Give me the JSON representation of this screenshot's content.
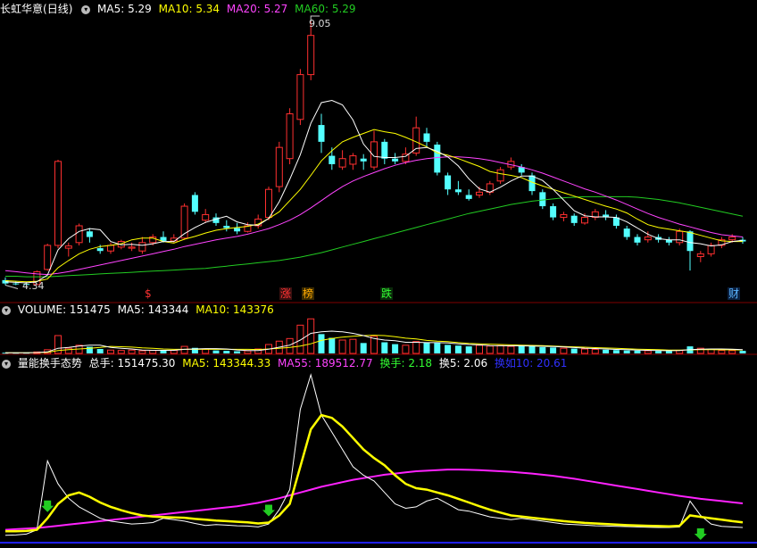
{
  "header": {
    "title": "长虹华意",
    "period": "(日线)",
    "ma5": "MA5: 5.29",
    "ma10": "MA10: 5.34",
    "ma20": "MA20: 5.27",
    "ma60": "MA60: 5.29"
  },
  "volume_header": {
    "title": "VOLUME: 151475",
    "ma5": "MA5: 143344",
    "ma10": "MA10: 143376"
  },
  "indicator_header": {
    "title": "量能换手态势",
    "total": "总手: 151475.30",
    "ma5": "MA5: 143344.33",
    "ma55": "MA55: 189512.77",
    "turnover": "换手: 2.18",
    "turnover5": "换5: 2.06",
    "turnover10": "换如10: 20.61"
  },
  "events": [
    {
      "label": "$",
      "color": "#ff3333",
      "bg": "none"
    },
    {
      "label": "涨",
      "color": "#ff3333",
      "bg": "#3a1010"
    },
    {
      "label": "榜",
      "color": "#ffaa00",
      "bg": "#3a2a00"
    },
    {
      "label": "跌",
      "color": "#33ff33",
      "bg": "#0a2a0a"
    },
    {
      "label": "财",
      "color": "#5ab4ff",
      "bg": "#0a2040"
    }
  ],
  "colors": {
    "up": "#ff3030",
    "down": "#54ffff",
    "ma5": "#ffffff",
    "ma10": "#ffff00",
    "ma20": "#ff44ff",
    "ma60": "#22cc22",
    "divider": "#800000",
    "bottom_axis": "#2020ff"
  },
  "chart_data": {
    "type": "candlestick",
    "price_high": "9.05",
    "price_low": "4.34",
    "n": 71,
    "candles": [
      {
        "o": 4.43,
        "c": 4.37,
        "h": 4.48,
        "l": 4.34
      },
      {
        "o": 4.37,
        "c": 4.36,
        "h": 4.41,
        "l": 4.34
      },
      {
        "o": 4.36,
        "c": 4.35,
        "h": 4.4,
        "l": 4.34
      },
      {
        "o": 4.35,
        "c": 4.58,
        "h": 4.6,
        "l": 4.34
      },
      {
        "o": 4.62,
        "c": 5.05,
        "h": 5.08,
        "l": 4.6
      },
      {
        "o": 5.05,
        "c": 6.55,
        "h": 6.58,
        "l": 5.0
      },
      {
        "o": 5.0,
        "c": 5.04,
        "h": 5.1,
        "l": 4.85
      },
      {
        "o": 5.1,
        "c": 5.4,
        "h": 5.44,
        "l": 5.05
      },
      {
        "o": 5.3,
        "c": 5.2,
        "h": 5.36,
        "l": 5.1
      },
      {
        "o": 5.0,
        "c": 4.95,
        "h": 5.06,
        "l": 4.9
      },
      {
        "o": 4.95,
        "c": 5.05,
        "h": 5.1,
        "l": 4.9
      },
      {
        "o": 5.02,
        "c": 5.12,
        "h": 5.15,
        "l": 4.98
      },
      {
        "o": 5.0,
        "c": 5.02,
        "h": 5.1,
        "l": 4.95
      },
      {
        "o": 4.95,
        "c": 5.1,
        "h": 5.2,
        "l": 4.9
      },
      {
        "o": 5.1,
        "c": 5.2,
        "h": 5.25,
        "l": 5.05
      },
      {
        "o": 5.2,
        "c": 5.13,
        "h": 5.3,
        "l": 5.1
      },
      {
        "o": 5.13,
        "c": 5.18,
        "h": 5.25,
        "l": 5.1
      },
      {
        "o": 5.18,
        "c": 5.75,
        "h": 5.8,
        "l": 5.15
      },
      {
        "o": 5.95,
        "c": 5.65,
        "h": 6.0,
        "l": 5.6
      },
      {
        "o": 5.5,
        "c": 5.6,
        "h": 5.7,
        "l": 5.45
      },
      {
        "o": 5.55,
        "c": 5.45,
        "h": 5.62,
        "l": 5.4
      },
      {
        "o": 5.4,
        "c": 5.36,
        "h": 5.5,
        "l": 5.3
      },
      {
        "o": 5.36,
        "c": 5.3,
        "h": 5.45,
        "l": 5.25
      },
      {
        "o": 5.3,
        "c": 5.4,
        "h": 5.46,
        "l": 5.28
      },
      {
        "o": 5.4,
        "c": 5.52,
        "h": 5.6,
        "l": 5.35
      },
      {
        "o": 5.55,
        "c": 6.05,
        "h": 6.1,
        "l": 5.5
      },
      {
        "o": 6.1,
        "c": 6.8,
        "h": 6.9,
        "l": 6.0
      },
      {
        "o": 6.6,
        "c": 7.4,
        "h": 7.5,
        "l": 6.5
      },
      {
        "o": 7.3,
        "c": 8.1,
        "h": 8.2,
        "l": 7.2
      },
      {
        "o": 8.1,
        "c": 8.8,
        "h": 9.05,
        "l": 8.0
      },
      {
        "o": 7.2,
        "c": 6.9,
        "h": 7.4,
        "l": 6.7
      },
      {
        "o": 6.65,
        "c": 6.5,
        "h": 6.8,
        "l": 6.4
      },
      {
        "o": 6.45,
        "c": 6.6,
        "h": 6.75,
        "l": 6.4
      },
      {
        "o": 6.5,
        "c": 6.65,
        "h": 6.7,
        "l": 6.4
      },
      {
        "o": 6.6,
        "c": 6.55,
        "h": 6.68,
        "l": 6.4
      },
      {
        "o": 6.45,
        "c": 6.9,
        "h": 7.1,
        "l": 6.4
      },
      {
        "o": 6.9,
        "c": 6.6,
        "h": 6.95,
        "l": 6.5
      },
      {
        "o": 6.6,
        "c": 6.55,
        "h": 6.7,
        "l": 6.5
      },
      {
        "o": 6.55,
        "c": 6.68,
        "h": 6.8,
        "l": 6.5
      },
      {
        "o": 6.7,
        "c": 7.15,
        "h": 7.35,
        "l": 6.65
      },
      {
        "o": 7.05,
        "c": 6.9,
        "h": 7.15,
        "l": 6.8
      },
      {
        "o": 6.85,
        "c": 6.35,
        "h": 6.9,
        "l": 6.3
      },
      {
        "o": 6.3,
        "c": 6.05,
        "h": 6.35,
        "l": 5.95
      },
      {
        "o": 6.05,
        "c": 6.0,
        "h": 6.2,
        "l": 5.95
      },
      {
        "o": 5.95,
        "c": 5.88,
        "h": 6.05,
        "l": 5.85
      },
      {
        "o": 5.95,
        "c": 6.0,
        "h": 6.1,
        "l": 5.9
      },
      {
        "o": 6.0,
        "c": 6.15,
        "h": 6.2,
        "l": 5.95
      },
      {
        "o": 6.2,
        "c": 6.4,
        "h": 6.45,
        "l": 6.15
      },
      {
        "o": 6.45,
        "c": 6.55,
        "h": 6.62,
        "l": 6.4
      },
      {
        "o": 6.45,
        "c": 6.35,
        "h": 6.5,
        "l": 6.3
      },
      {
        "o": 6.3,
        "c": 6.02,
        "h": 6.35,
        "l": 5.95
      },
      {
        "o": 6.0,
        "c": 5.75,
        "h": 6.05,
        "l": 5.7
      },
      {
        "o": 5.75,
        "c": 5.55,
        "h": 5.8,
        "l": 5.5
      },
      {
        "o": 5.55,
        "c": 5.6,
        "h": 5.65,
        "l": 5.48
      },
      {
        "o": 5.58,
        "c": 5.45,
        "h": 5.62,
        "l": 5.4
      },
      {
        "o": 5.45,
        "c": 5.55,
        "h": 5.62,
        "l": 5.42
      },
      {
        "o": 5.55,
        "c": 5.65,
        "h": 5.7,
        "l": 5.5
      },
      {
        "o": 5.6,
        "c": 5.55,
        "h": 5.68,
        "l": 5.5
      },
      {
        "o": 5.55,
        "c": 5.4,
        "h": 5.6,
        "l": 5.35
      },
      {
        "o": 5.35,
        "c": 5.2,
        "h": 5.4,
        "l": 5.15
      },
      {
        "o": 5.2,
        "c": 5.1,
        "h": 5.25,
        "l": 5.05
      },
      {
        "o": 5.15,
        "c": 5.2,
        "h": 5.3,
        "l": 5.1
      },
      {
        "o": 5.2,
        "c": 5.15,
        "h": 5.25,
        "l": 5.1
      },
      {
        "o": 5.15,
        "c": 5.1,
        "h": 5.2,
        "l": 5.05
      },
      {
        "o": 5.1,
        "c": 5.3,
        "h": 5.35,
        "l": 5.05
      },
      {
        "o": 5.3,
        "c": 4.95,
        "h": 5.32,
        "l": 4.6
      },
      {
        "o": 4.85,
        "c": 4.9,
        "h": 4.95,
        "l": 4.75
      },
      {
        "o": 4.9,
        "c": 5.05,
        "h": 5.1,
        "l": 4.85
      },
      {
        "o": 5.05,
        "c": 5.15,
        "h": 5.2,
        "l": 5.0
      },
      {
        "o": 5.15,
        "c": 5.2,
        "h": 5.25,
        "l": 5.1
      },
      {
        "o": 5.15,
        "c": 5.12,
        "h": 5.2,
        "l": 5.08
      }
    ],
    "ma5_values": [
      4.4,
      4.39,
      4.38,
      4.4,
      4.52,
      4.97,
      5.17,
      5.3,
      5.35,
      5.33,
      5.12,
      5.06,
      5.07,
      5.05,
      5.08,
      5.12,
      5.12,
      5.26,
      5.37,
      5.46,
      5.52,
      5.57,
      5.47,
      5.42,
      5.41,
      5.53,
      5.83,
      6.23,
      6.67,
      7.23,
      7.6,
      7.64,
      7.56,
      7.29,
      6.86,
      6.64,
      6.62,
      6.62,
      6.64,
      6.78,
      6.8,
      6.73,
      6.63,
      6.47,
      6.24,
      6.06,
      6.0,
      6.09,
      6.2,
      6.29,
      6.29,
      6.21,
      6.05,
      5.86,
      5.67,
      5.58,
      5.56,
      5.56,
      5.55,
      5.47,
      5.36,
      5.25,
      5.17,
      5.15,
      5.15,
      5.1,
      5.08,
      5.04,
      5.06,
      5.12,
      5.14
    ],
    "ma10_values": [
      4.42,
      4.41,
      4.4,
      4.41,
      4.45,
      4.65,
      4.78,
      4.9,
      4.98,
      5.03,
      5.05,
      5.08,
      5.15,
      5.18,
      5.18,
      5.12,
      5.09,
      5.16,
      5.21,
      5.27,
      5.32,
      5.35,
      5.37,
      5.39,
      5.43,
      5.53,
      5.65,
      5.85,
      6.05,
      6.3,
      6.56,
      6.74,
      6.9,
      6.98,
      7.05,
      7.12,
      7.08,
      7.05,
      6.98,
      6.9,
      6.81,
      6.7,
      6.66,
      6.6,
      6.53,
      6.46,
      6.37,
      6.33,
      6.3,
      6.26,
      6.18,
      6.11,
      6.05,
      5.99,
      5.93,
      5.87,
      5.81,
      5.75,
      5.7,
      5.63,
      5.52,
      5.42,
      5.37,
      5.34,
      5.31,
      5.28,
      5.23,
      5.18,
      5.13,
      5.12,
      5.12
    ],
    "ma20_values": [
      4.6,
      4.58,
      4.56,
      4.54,
      4.53,
      4.55,
      4.58,
      4.62,
      4.66,
      4.7,
      4.74,
      4.78,
      4.82,
      4.86,
      4.9,
      4.94,
      4.98,
      5.03,
      5.07,
      5.11,
      5.15,
      5.18,
      5.21,
      5.25,
      5.3,
      5.35,
      5.42,
      5.5,
      5.6,
      5.72,
      5.85,
      5.98,
      6.1,
      6.2,
      6.28,
      6.35,
      6.42,
      6.48,
      6.53,
      6.57,
      6.6,
      6.62,
      6.63,
      6.63,
      6.62,
      6.6,
      6.57,
      6.53,
      6.49,
      6.45,
      6.4,
      6.34,
      6.27,
      6.2,
      6.13,
      6.06,
      6.0,
      5.93,
      5.86,
      5.78,
      5.7,
      5.62,
      5.55,
      5.49,
      5.43,
      5.38,
      5.33,
      5.28,
      5.24,
      5.22,
      5.2
    ],
    "ma60_values": [
      4.5,
      4.5,
      4.49,
      4.49,
      4.49,
      4.5,
      4.51,
      4.52,
      4.53,
      4.54,
      4.55,
      4.56,
      4.57,
      4.58,
      4.59,
      4.6,
      4.61,
      4.62,
      4.63,
      4.64,
      4.66,
      4.68,
      4.7,
      4.72,
      4.74,
      4.76,
      4.78,
      4.81,
      4.84,
      4.88,
      4.92,
      4.97,
      5.02,
      5.07,
      5.12,
      5.17,
      5.22,
      5.27,
      5.32,
      5.37,
      5.42,
      5.47,
      5.52,
      5.57,
      5.62,
      5.66,
      5.7,
      5.74,
      5.78,
      5.81,
      5.84,
      5.86,
      5.88,
      5.9,
      5.91,
      5.92,
      5.92,
      5.92,
      5.92,
      5.92,
      5.91,
      5.89,
      5.87,
      5.84,
      5.81,
      5.77,
      5.73,
      5.69,
      5.65,
      5.61,
      5.57
    ],
    "volume": [
      9000,
      9000,
      9500,
      20000,
      50000,
      240000,
      70000,
      110000,
      90000,
      60000,
      45000,
      40000,
      45000,
      35000,
      40000,
      45000,
      40000,
      95000,
      75000,
      55000,
      40000,
      35000,
      30000,
      35000,
      60000,
      120000,
      165000,
      200000,
      380000,
      465000,
      260000,
      210000,
      180000,
      190000,
      140000,
      230000,
      150000,
      125000,
      110000,
      160000,
      150000,
      140000,
      115000,
      105000,
      95000,
      110000,
      100000,
      105000,
      95000,
      100000,
      95000,
      85000,
      80000,
      70000,
      65000,
      60000,
      55000,
      50000,
      45000,
      40000,
      38000,
      36000,
      34000,
      33000,
      40000,
      95000,
      70000,
      55000,
      40000,
      38000,
      35000
    ],
    "vol_ma5": [
      9000,
      9000,
      9100,
      12000,
      20000,
      70000,
      80000,
      100000,
      110000,
      110000,
      80000,
      70000,
      60000,
      45000,
      42000,
      42000,
      42000,
      55000,
      60000,
      65000,
      65000,
      60000,
      47000,
      40000,
      40000,
      57000,
      84000,
      112000,
      180000,
      270000,
      290000,
      300000,
      290000,
      270000,
      240000,
      200000,
      180000,
      170000,
      150000,
      150000,
      145000,
      145000,
      140000,
      130000,
      120000,
      115000,
      105000,
      103000,
      102000,
      102000,
      100000,
      96000,
      92000,
      86000,
      79000,
      71000,
      66000,
      60000,
      54000,
      50000,
      46000,
      42000,
      39000,
      37000,
      40000,
      52000,
      56000,
      60000,
      60000,
      57000,
      50000
    ],
    "vol_ma10": [
      10000,
      10000,
      10000,
      11000,
      15000,
      40000,
      50000,
      60000,
      70000,
      80000,
      95000,
      90000,
      85000,
      75000,
      70000,
      60000,
      55000,
      55000,
      55000,
      55000,
      55000,
      55000,
      55000,
      55000,
      53000,
      60000,
      70000,
      80000,
      100000,
      130000,
      175000,
      200000,
      220000,
      230000,
      240000,
      245000,
      240000,
      225000,
      205000,
      195000,
      175000,
      165000,
      160000,
      145000,
      135000,
      130000,
      125000,
      120000,
      115000,
      110000,
      108000,
      104000,
      99000,
      94000,
      89000,
      84000,
      78000,
      73000,
      68000,
      62000,
      58000,
      54000,
      50000,
      46000,
      44000,
      48000,
      50000,
      50000,
      49000,
      48000,
      47000
    ],
    "indicator_white": [
      1,
      2,
      5,
      20,
      260,
      180,
      130,
      100,
      80,
      60,
      50,
      45,
      40,
      42,
      45,
      60,
      55,
      50,
      42,
      35,
      38,
      36,
      34,
      33,
      30,
      40,
      90,
      160,
      440,
      560,
      420,
      360,
      300,
      240,
      210,
      190,
      150,
      110,
      95,
      100,
      120,
      130,
      110,
      90,
      85,
      75,
      65,
      60,
      55,
      60,
      55,
      50,
      45,
      40,
      38,
      36,
      34,
      33,
      32,
      31,
      30,
      29,
      28,
      28,
      30,
      120,
      70,
      40,
      32,
      30,
      28
    ],
    "indicator_yellow": [
      15,
      15,
      16,
      20,
      60,
      110,
      140,
      150,
      135,
      115,
      100,
      88,
      78,
      70,
      66,
      64,
      63,
      62,
      58,
      55,
      52,
      50,
      48,
      46,
      42,
      45,
      70,
      110,
      240,
      370,
      420,
      410,
      380,
      340,
      300,
      270,
      245,
      210,
      180,
      165,
      160,
      150,
      140,
      128,
      115,
      102,
      90,
      80,
      70,
      66,
      62,
      58,
      54,
      50,
      47,
      44,
      42,
      40,
      38,
      36,
      35,
      34,
      33,
      32,
      34,
      70,
      65,
      60,
      55,
      50,
      46
    ],
    "indicator_magenta": [
      20,
      22,
      24,
      26,
      30,
      34,
      38,
      42,
      46,
      50,
      54,
      58,
      62,
      66,
      70,
      74,
      78,
      82,
      86,
      90,
      94,
      98,
      102,
      108,
      114,
      122,
      130,
      140,
      150,
      160,
      170,
      178,
      186,
      194,
      200,
      206,
      212,
      216,
      220,
      224,
      226,
      228,
      230,
      230,
      229,
      228,
      226,
      224,
      222,
      219,
      216,
      212,
      208,
      203,
      198,
      192,
      186,
      180,
      174,
      168,
      162,
      156,
      150,
      144,
      138,
      133,
      128,
      124,
      120,
      116,
      112
    ]
  }
}
